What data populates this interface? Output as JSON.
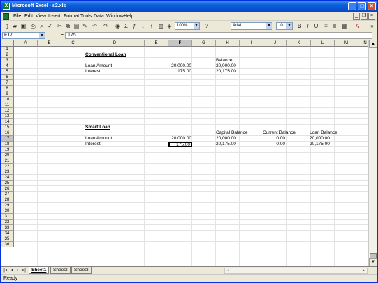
{
  "window": {
    "title": "Microsoft Excel - s2.xls"
  },
  "menu": [
    "File",
    "Edit",
    "View",
    "Insert",
    "Format",
    "Tools",
    "Data",
    "Window",
    "Help"
  ],
  "toolbar": {
    "zoom": "100%",
    "font": "Arial",
    "size": "10"
  },
  "formula_bar": {
    "name_box": "F17",
    "fx": "=",
    "value": "175"
  },
  "columns": [
    "A",
    "B",
    "C",
    "D",
    "E",
    "F",
    "G",
    "H",
    "I",
    "J",
    "K",
    "L",
    "M",
    "N"
  ],
  "rows": [
    "1",
    "2",
    "3",
    "4",
    "5",
    "6",
    "7",
    "8",
    "9",
    "10",
    "11",
    "12",
    "13",
    "14",
    "15",
    "16",
    "17",
    "18",
    "19",
    "20",
    "21",
    "22",
    "23",
    "24",
    "25",
    "26",
    "27",
    "28",
    "29",
    "30",
    "31",
    "32",
    "33",
    "34",
    "35",
    "36"
  ],
  "cells": {
    "d2": "Conventional Loan",
    "h3": "Balance",
    "d4": "Loan Amount",
    "f4": "20,000.00",
    "h4": "20,000.00",
    "d5": "Interest",
    "f5": "175.00",
    "h5": "20,175.00",
    "d14": "Smart Loan",
    "h15": "Capital Balance",
    "j15": "Current Balance",
    "l15": "Loan Balance",
    "d16": "Loan Amount",
    "f16": "20,000.00",
    "h16": "20,000.00",
    "j16": "0.00",
    "l16": "20,000.00",
    "d17": "Interest",
    "f17": "175.00",
    "h17": "20,175.00",
    "j17": "0.00",
    "l17": "20,175.00"
  },
  "sheets": [
    "Sheet1",
    "Sheet2",
    "Sheet3"
  ],
  "status": "Ready"
}
